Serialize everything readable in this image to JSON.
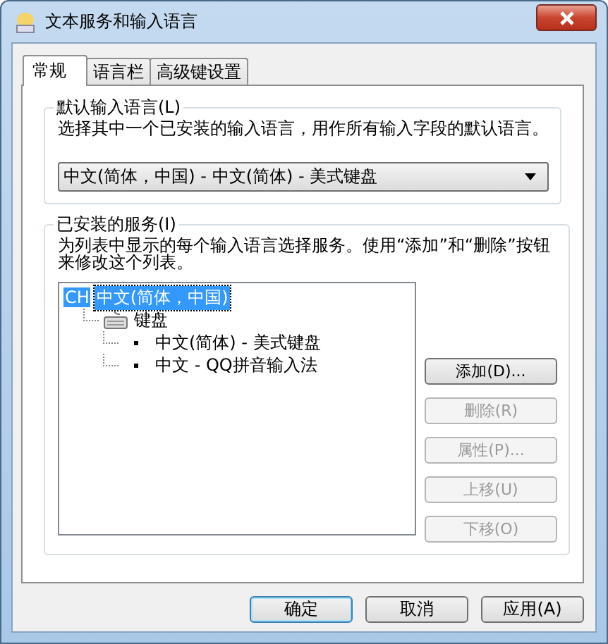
{
  "window": {
    "title": "文本服务和输入语言"
  },
  "tabs": [
    {
      "label": "常规",
      "selected": true
    },
    {
      "label": "语言栏",
      "selected": false
    },
    {
      "label": "高级键设置",
      "selected": false
    }
  ],
  "default_language": {
    "title": "默认输入语言(L)",
    "description": "选择其中一个已安装的输入语言，用作所有输入字段的默认语言。",
    "dropdown": {
      "value": "中文(简体，中国) - 中文(简体) - 美式键盘"
    }
  },
  "installed_services": {
    "title": "已安装的服务(I)",
    "description": "为列表中显示的每个输入语言选择服务。使用“添加”和“删除”按钮来修改这个列表。",
    "tree": [
      {
        "kind": "language",
        "badge": "CH",
        "label": "中文(简体，中国)",
        "selected": true,
        "children": [
          {
            "kind": "category",
            "label": "键盘",
            "selected": false,
            "children": [
              {
                "kind": "service",
                "label": "中文(简体) - 美式键盘",
                "selected": false
              },
              {
                "kind": "service",
                "label": "中文 - QQ拼音输入法",
                "selected": false
              }
            ]
          }
        ]
      }
    ],
    "buttons": [
      {
        "label": "添加(D)...",
        "disabled": false
      },
      {
        "label": "删除(R)",
        "disabled": true
      },
      {
        "label": "属性(P)...",
        "disabled": true
      },
      {
        "label": "上移(U)",
        "disabled": true
      },
      {
        "label": "下移(O)",
        "disabled": true
      }
    ]
  },
  "footer_buttons": [
    {
      "label": "确定",
      "default": true
    },
    {
      "label": "取消",
      "default": false
    },
    {
      "label": "应用(A)",
      "default": false
    }
  ]
}
